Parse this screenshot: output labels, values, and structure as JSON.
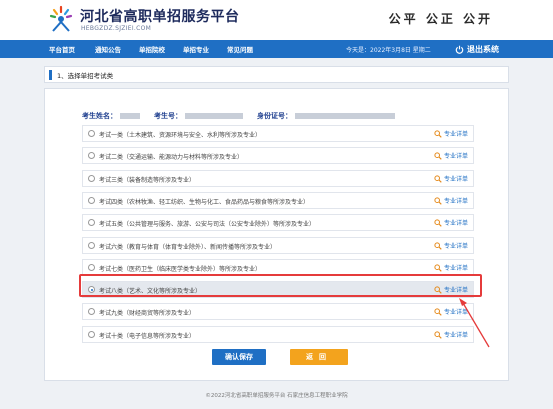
{
  "header": {
    "site_title": "河北省高职单招服务平台",
    "site_url": "HEBGZDZ.SJZIEI.COM",
    "slogan": "公平  公正  公开"
  },
  "nav": {
    "items": [
      "平台首页",
      "通知公告",
      "单招院校",
      "单招专业",
      "常见问题"
    ],
    "date_text": "今天是：2022年3月8日 星期二",
    "logout_label": "退出系统"
  },
  "section": {
    "title": "1、选择单招考试类"
  },
  "student": {
    "name_label": "考生姓名：",
    "exam_no_label": "考生号：",
    "id_label": "身份证号："
  },
  "options": [
    {
      "text": "考试一类（土木建筑、资源环境与安全、水利等所涉及专业）",
      "selected": false
    },
    {
      "text": "考试二类（交通运输、能源动力与材料等所涉及专业）",
      "selected": false
    },
    {
      "text": "考试三类（装备制造等所涉及专业）",
      "selected": false
    },
    {
      "text": "考试四类（农林牧渔、轻工纺织、生物与化工、食品药品与粮食等所涉及专业）",
      "selected": false
    },
    {
      "text": "考试五类（公共管理与服务、旅游、公安与司法（公安专业除外）等所涉及专业）",
      "selected": false
    },
    {
      "text": "考试六类（教育与体育（体育专业除外）、新闻传播等所涉及专业）",
      "selected": false
    },
    {
      "text": "考试七类（医药卫生（临床医学类专业除外）等所涉及专业）",
      "selected": false
    },
    {
      "text": "考试八类（艺术、文化等所涉及专业）",
      "selected": true
    },
    {
      "text": "考试九类（财经商贸等所涉及专业）",
      "selected": false
    },
    {
      "text": "考试十类（电子信息等所涉及专业）",
      "selected": false
    }
  ],
  "detail_label": "专业详单",
  "buttons": {
    "save": "确认保存",
    "back": "返回"
  },
  "footer": "©2022河北省高职单招服务平台  石家庄信息工程职业学院",
  "colors": {
    "primary": "#1f6fc4",
    "accent": "#f3a31d",
    "annotation": "#e53b3b"
  }
}
